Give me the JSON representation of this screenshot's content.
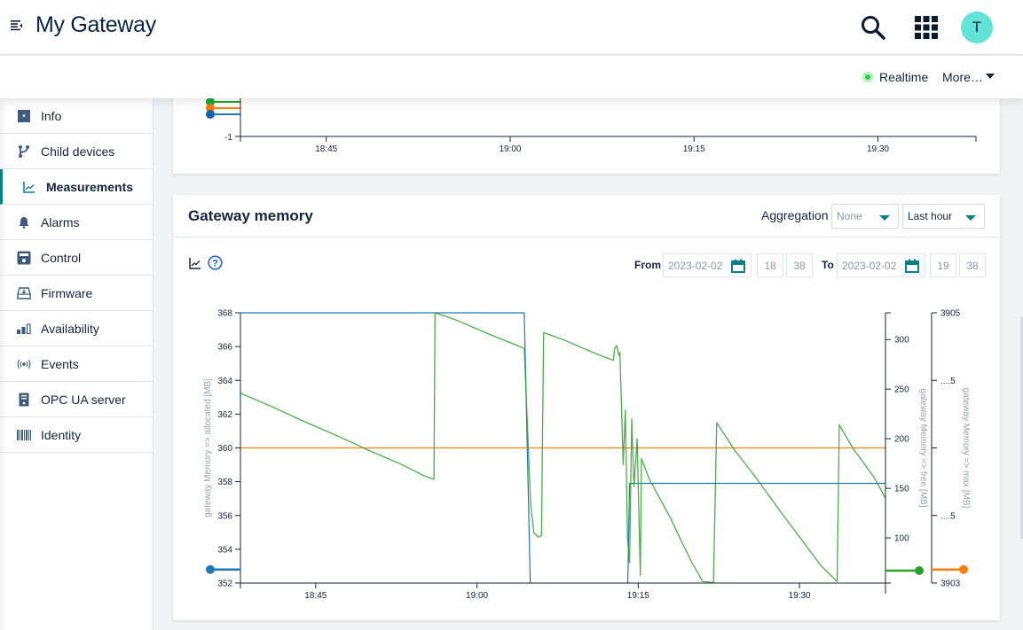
{
  "header": {
    "title": "My Gateway",
    "avatar_initial": "T",
    "icons": [
      "menu-collapse-icon",
      "search-icon",
      "apps-grid-icon"
    ]
  },
  "actionbar": {
    "realtime_label": "Realtime",
    "more_label": "More…"
  },
  "sidebar": {
    "items": [
      {
        "label": "Info",
        "icon": "info-icon",
        "active": false
      },
      {
        "label": "Child devices",
        "icon": "child-devices-icon",
        "active": false
      },
      {
        "label": "Measurements",
        "icon": "measurements-icon",
        "active": true
      },
      {
        "label": "Alarms",
        "icon": "bell-icon",
        "active": false
      },
      {
        "label": "Control",
        "icon": "control-icon",
        "active": false
      },
      {
        "label": "Firmware",
        "icon": "firmware-icon",
        "active": false
      },
      {
        "label": "Availability",
        "icon": "availability-icon",
        "active": false
      },
      {
        "label": "Events",
        "icon": "events-icon",
        "active": false
      },
      {
        "label": "OPC UA server",
        "icon": "opcua-server-icon",
        "active": false
      },
      {
        "label": "Identity",
        "icon": "barcode-icon",
        "active": false
      }
    ]
  },
  "colors": {
    "accent": "#0b7f86",
    "series_allocated": "#1f77b4",
    "series_free": "#2ca02c",
    "series_max": "#ff7f0e",
    "realtime_dot": "#1cd93a",
    "avatar_bg": "#63e2d7"
  },
  "top_card": {
    "y_tick": "-1",
    "x_ticks": [
      "18:45",
      "19:00",
      "19:15",
      "19:30"
    ]
  },
  "memory_card": {
    "title": "Gateway memory",
    "aggregation_label": "Aggregation",
    "aggregation_value": "None",
    "range_value": "Last hour",
    "from_label": "From",
    "from_date": "2023-02-02",
    "from_hour": "18",
    "from_minute": "38",
    "to_label": "To",
    "to_date": "2023-02-02",
    "to_hour": "19",
    "to_minute": "38",
    "time_separator": ":"
  },
  "chart_data": {
    "type": "line",
    "title": "Gateway memory",
    "x": {
      "start": "18:38",
      "end": "19:38",
      "ticks": [
        "18:45",
        "19:00",
        "19:15",
        "19:30"
      ],
      "unit": "minutes since 18:38"
    },
    "axes": [
      {
        "id": "allocated",
        "label": "gateway Memory => allocated [MB]",
        "side": "left",
        "range": [
          352,
          368
        ],
        "ticks": [
          "352",
          "354",
          "356",
          "358",
          "360",
          "362",
          "364",
          "366",
          "368"
        ]
      },
      {
        "id": "free",
        "label": "gateway Memory => free [MB]",
        "side": "right",
        "range": [
          54.5,
          327
        ],
        "ticks": [
          "100",
          "150",
          "200",
          "250",
          "300"
        ]
      },
      {
        "id": "max",
        "label": "gateway Memory => max [MB]",
        "side": "right-outer",
        "range": [
          3903,
          3905
        ],
        "ticks": [
          "3903",
          "....5",
          "....5",
          "3905"
        ]
      }
    ],
    "series": [
      {
        "name": "gateway Memory => allocated [MB]",
        "axis": "allocated",
        "color": "#1f77b4",
        "points": [
          [
            0,
            368
          ],
          [
            26.4,
            368
          ],
          [
            27.0,
            351
          ],
          [
            36.0,
            351
          ],
          [
            36.2,
            357.9
          ],
          [
            60,
            357.9
          ]
        ]
      },
      {
        "name": "gateway Memory => max [MB]",
        "axis": "max",
        "color": "#ff7f0e",
        "points": [
          [
            0,
            3904
          ],
          [
            60,
            3904
          ]
        ]
      },
      {
        "name": "gateway Memory => free [MB]",
        "axis": "free",
        "color": "#2ca02c",
        "points": [
          [
            0,
            246
          ],
          [
            3,
            232
          ],
          [
            6,
            217
          ],
          [
            9,
            203
          ],
          [
            12,
            188
          ],
          [
            15,
            174
          ],
          [
            17,
            163
          ],
          [
            18,
            159
          ],
          [
            18.1,
            327
          ],
          [
            20,
            320
          ],
          [
            23,
            306
          ],
          [
            26,
            293
          ],
          [
            26.4,
            291
          ],
          [
            27,
            133
          ],
          [
            27.3,
            105
          ],
          [
            27.7,
            101
          ],
          [
            28.0,
            102
          ],
          [
            28.2,
            307
          ],
          [
            30,
            300
          ],
          [
            33,
            286
          ],
          [
            34.7,
            279
          ],
          [
            34.8,
            291
          ],
          [
            35.0,
            294
          ],
          [
            35.2,
            284
          ],
          [
            35.3,
            287
          ],
          [
            35.6,
            174
          ],
          [
            35.8,
            229
          ],
          [
            36.0,
            100
          ],
          [
            36.2,
            75
          ],
          [
            36.4,
            220
          ],
          [
            36.6,
            152
          ],
          [
            36.9,
            200
          ],
          [
            37.2,
            62
          ],
          [
            37.3,
            180
          ],
          [
            38,
            160
          ],
          [
            39,
            140
          ],
          [
            40,
            120
          ],
          [
            41,
            97
          ],
          [
            42,
            75
          ],
          [
            43,
            56
          ],
          [
            44,
            55
          ],
          [
            44.3,
            216
          ],
          [
            46,
            188
          ],
          [
            48,
            160
          ],
          [
            50,
            130
          ],
          [
            52,
            101
          ],
          [
            54,
            72
          ],
          [
            55.5,
            56
          ],
          [
            55.7,
            214
          ],
          [
            57,
            190
          ],
          [
            59,
            160
          ],
          [
            60,
            140
          ]
        ]
      }
    ],
    "legend_markers": [
      {
        "series": "allocated",
        "color": "#1f77b4",
        "value": 352.8,
        "position": "left"
      },
      {
        "series": "free",
        "color": "#2ca02c",
        "value": 67,
        "position": "right"
      },
      {
        "series": "max",
        "color": "#ff7f0e",
        "value": 3903.1,
        "position": "right-outer"
      }
    ]
  }
}
